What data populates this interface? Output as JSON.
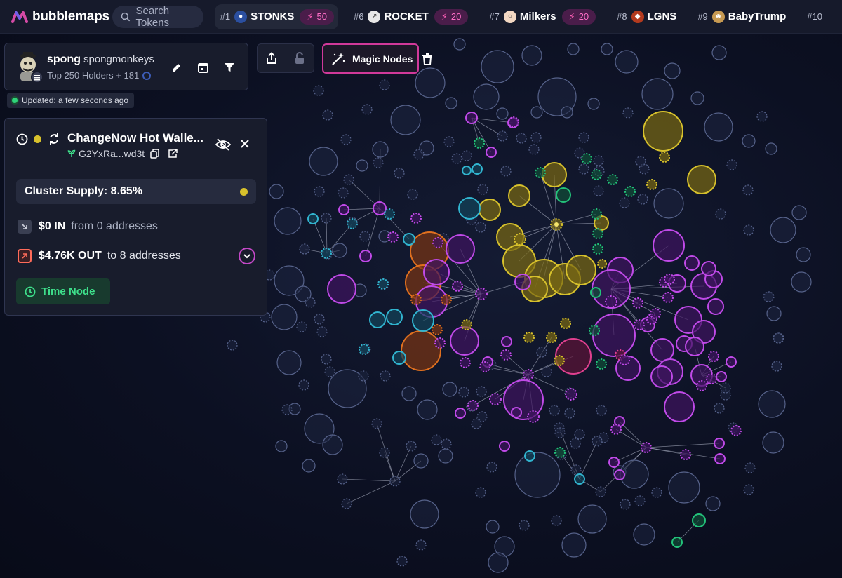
{
  "app": {
    "name": "bubblemaps"
  },
  "search": {
    "placeholder": "Search Tokens"
  },
  "trending": [
    {
      "rank": "#1",
      "symbol": "STONKS",
      "boost": "50",
      "icon": "stonks-token-icon"
    },
    {
      "rank": "#6",
      "symbol": "ROCKET",
      "boost": "20",
      "icon": "rocket-token-icon"
    },
    {
      "rank": "#7",
      "symbol": "Milkers",
      "boost": "20",
      "icon": "milkers-token-icon"
    },
    {
      "rank": "#8",
      "symbol": "LGNS",
      "boost": "",
      "icon": "lgns-token-icon"
    },
    {
      "rank": "#9",
      "symbol": "BabyTrump",
      "boost": "",
      "icon": "babytrump-token-icon"
    },
    {
      "rank": "#10",
      "symbol": "",
      "boost": "",
      "icon": ""
    }
  ],
  "token": {
    "symbol": "spong",
    "name": "spongmonkeys",
    "subtitle": "Top 250 Holders + 181",
    "updated": "Updated: a few seconds ago"
  },
  "toolbar": {
    "magic_label": "Magic Nodes"
  },
  "wallet": {
    "title": "ChangeNow Hot Walle...",
    "address": "G2YxRa...wd3t",
    "cluster_supply": "Cluster Supply: 8.65%",
    "in_amount": "$0 IN",
    "in_desc": "from 0 addresses",
    "out_amount": "$4.76K OUT",
    "out_desc": "to 8 addresses",
    "time_node_label": "Time Node"
  },
  "colors": {
    "accent_magenta": "#d1399a",
    "cluster_yellow": "#d7c12c",
    "purple_nodes": "#a23cd0",
    "orange_nodes": "#e0701f",
    "teal_nodes": "#2aa6bf",
    "green_nodes": "#23c27a",
    "background": "#0c1022"
  }
}
